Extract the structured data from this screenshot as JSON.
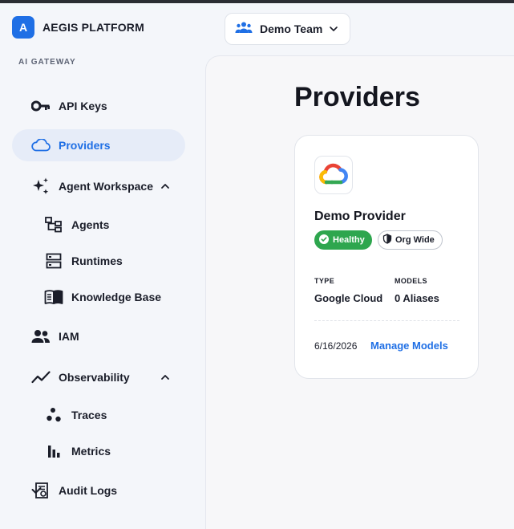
{
  "brand": {
    "logo_letter": "A",
    "name": "AEGIS PLATFORM"
  },
  "team_selector": {
    "label": "Demo Team",
    "icon": "team-icon"
  },
  "sidebar": {
    "section_label": "AI GATEWAY",
    "items": [
      {
        "label": "API Keys",
        "icon": "key-icon"
      },
      {
        "label": "Providers",
        "icon": "cloud-icon",
        "active": true
      },
      {
        "label": "Agent Workspace",
        "icon": "sparkles-icon",
        "expanded": true,
        "children": [
          {
            "label": "Agents",
            "icon": "hierarchy-icon"
          },
          {
            "label": "Runtimes",
            "icon": "server-icon"
          },
          {
            "label": "Knowledge Base",
            "icon": "book-icon"
          }
        ]
      },
      {
        "label": "IAM",
        "icon": "people-icon"
      },
      {
        "label": "Observability",
        "icon": "trend-icon",
        "expanded": true,
        "children": [
          {
            "label": "Traces",
            "icon": "traces-icon"
          },
          {
            "label": "Metrics",
            "icon": "bar-chart-icon"
          }
        ]
      },
      {
        "label": "Audit Logs",
        "icon": "audit-icon"
      }
    ]
  },
  "main": {
    "title": "Providers",
    "providers": [
      {
        "name": "Demo Provider",
        "logo": "google-cloud-logo",
        "status_badge": "Healthy",
        "scope_badge": "Org Wide",
        "type_label": "TYPE",
        "type_value": "Google Cloud",
        "models_label": "MODELS",
        "models_value": "0 Aliases",
        "date": "6/16/2026",
        "action": "Manage Models"
      }
    ]
  },
  "colors": {
    "accent": "#1f6fe5",
    "healthy": "#2ea64e",
    "active_bg": "#e6ecf8",
    "sidebar_bg": "#f4f6fa"
  }
}
